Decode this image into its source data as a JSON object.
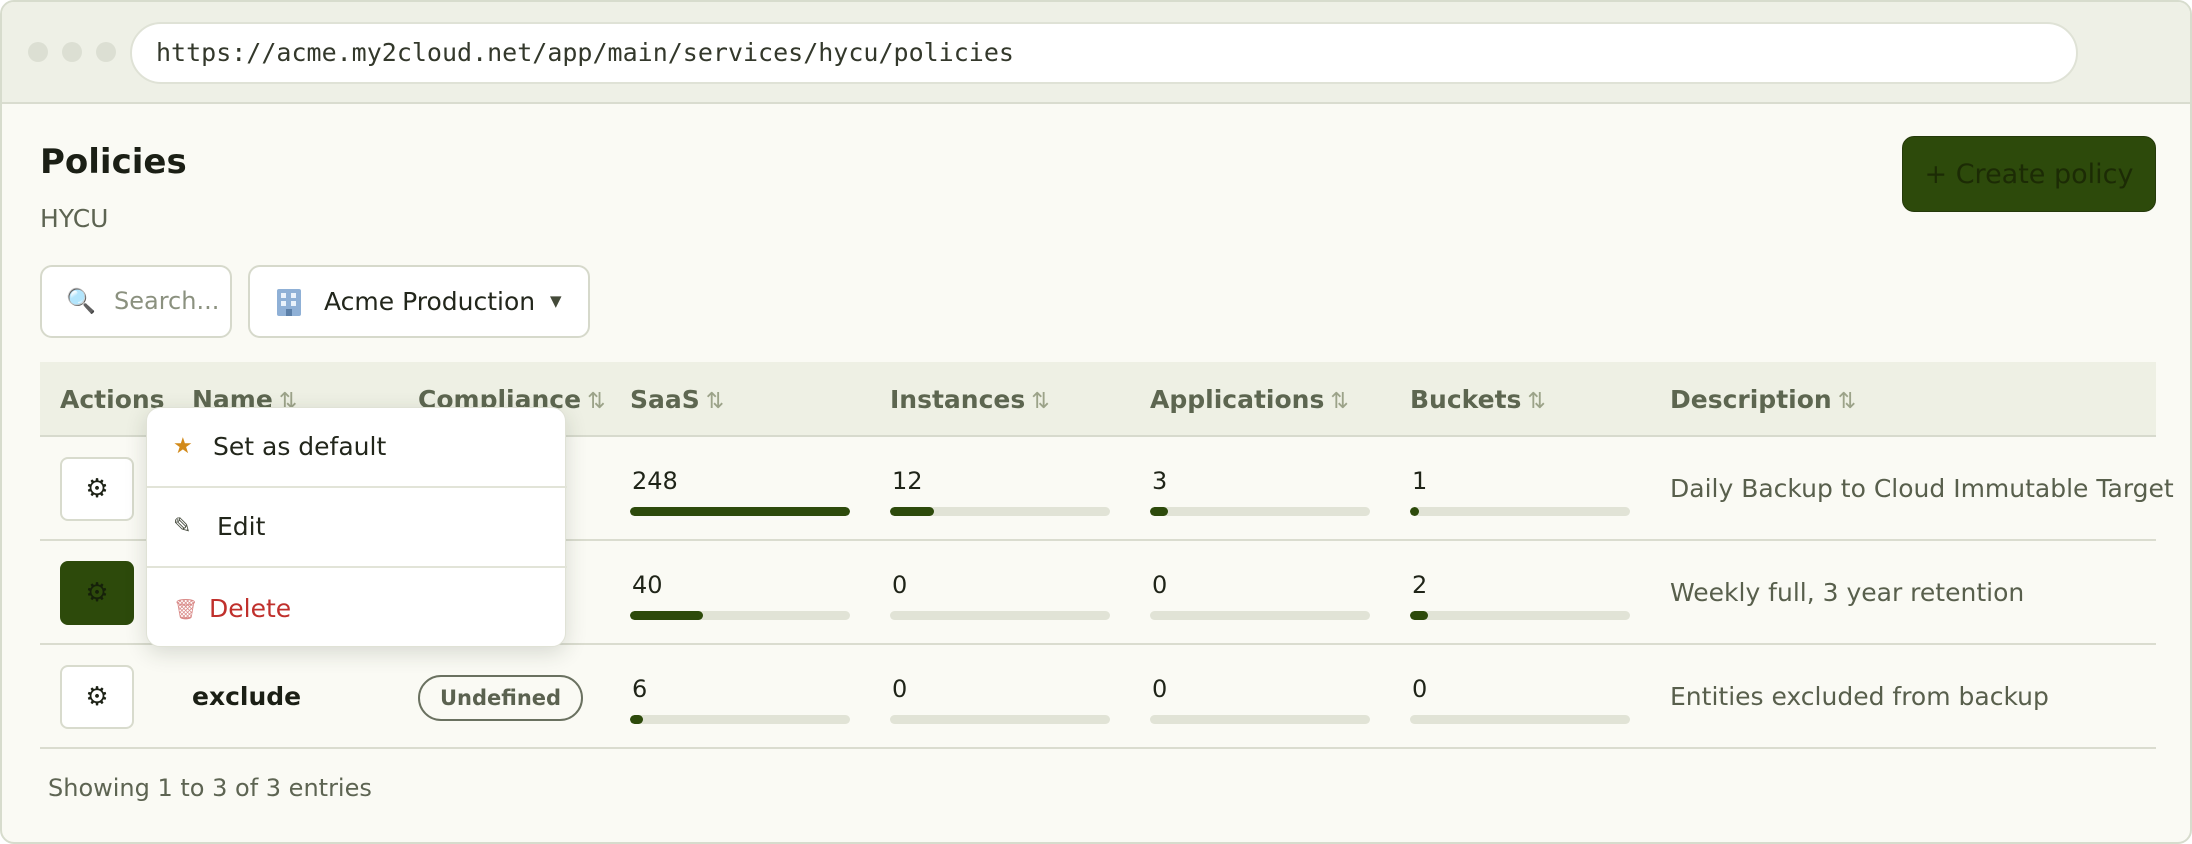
{
  "browser": {
    "url": "https://acme.my2cloud.net/app/main/services/hycu/policies"
  },
  "header": {
    "title": "Policies",
    "subtitle": "HYCU",
    "create_label": "+ Create policy"
  },
  "filters": {
    "search_placeholder": "Search...",
    "organization": "Acme Production"
  },
  "table": {
    "columns": [
      {
        "label": "Actions",
        "sortable": false
      },
      {
        "label": "Name",
        "sortable": true
      },
      {
        "label": "Compliance",
        "sortable": true
      },
      {
        "label": "SaaS",
        "sortable": true
      },
      {
        "label": "Instances",
        "sortable": true
      },
      {
        "label": "Applications",
        "sortable": true
      },
      {
        "label": "Buckets",
        "sortable": true
      },
      {
        "label": "Description",
        "sortable": true
      }
    ],
    "sort_glyph": "⇅",
    "rows": [
      {
        "name": "",
        "compliance": "",
        "saas": "248",
        "instances": "12",
        "applications": "3",
        "buckets": "1",
        "saas_pct": 1.0,
        "instances_pct": 0.2,
        "applications_pct": 0.08,
        "buckets_pct": 0.04,
        "description": "Daily Backup to Cloud Immutable Target",
        "menu_open": false
      },
      {
        "name": "",
        "compliance": "",
        "saas": "40",
        "instances": "0",
        "applications": "0",
        "buckets": "2",
        "saas_pct": 0.33,
        "instances_pct": 0,
        "applications_pct": 0,
        "buckets_pct": 0.08,
        "description": "Weekly full, 3 year retention",
        "menu_open": true
      },
      {
        "name": "exclude",
        "compliance": "Undefined",
        "saas": "6",
        "instances": "0",
        "applications": "0",
        "buckets": "0",
        "saas_pct": 0.06,
        "instances_pct": 0,
        "applications_pct": 0,
        "buckets_pct": 0,
        "description": "Entities excluded from backup",
        "menu_open": false
      }
    ],
    "footer": "Showing 1 to 3 of 3 entries"
  },
  "context_menu": {
    "items": [
      {
        "label": "Set as default",
        "icon": "star-icon",
        "glyph": "★"
      },
      {
        "label": "Edit",
        "icon": "pencil-icon",
        "glyph": "✎"
      },
      {
        "label": "Delete",
        "icon": "trash-icon",
        "glyph": "🗑"
      }
    ]
  },
  "icons": {
    "gear": "⚙",
    "search": "🔍",
    "chevron": "▼"
  },
  "colors": {
    "accent": "#2d4a0b",
    "danger": "#c0302c",
    "star": "#d28a1a",
    "background": "#fafaf4",
    "header_bg": "#eef0e4"
  }
}
